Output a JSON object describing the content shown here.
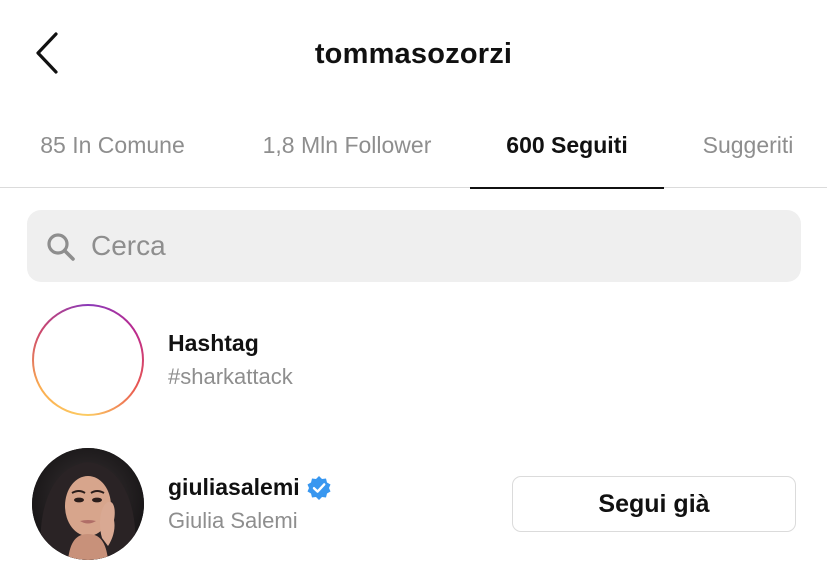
{
  "header": {
    "title": "tommasozorzi",
    "back_icon": "chevron-left-icon"
  },
  "tabs": [
    {
      "label": "85 In Comune",
      "active": false
    },
    {
      "label": "1,8 Mln Follower",
      "active": false
    },
    {
      "label": "600 Seguiti",
      "active": true
    },
    {
      "label": "Suggeriti",
      "active": false
    }
  ],
  "search": {
    "placeholder": "Cerca",
    "value": "",
    "icon": "search-icon"
  },
  "list": [
    {
      "type": "hashtag",
      "title": "Hashtag",
      "subtitle": "#sharkattack",
      "icon": "hashtag-icon"
    },
    {
      "type": "user",
      "username": "giuliasalemi",
      "full_name": "Giulia Salemi",
      "verified": true,
      "button_label": "Segui già"
    }
  ],
  "colors": {
    "text_primary": "#111111",
    "text_secondary": "#8e8e8e",
    "divider": "#dbdbdb",
    "search_bg": "#efefef",
    "verified_blue": "#3897f0"
  }
}
